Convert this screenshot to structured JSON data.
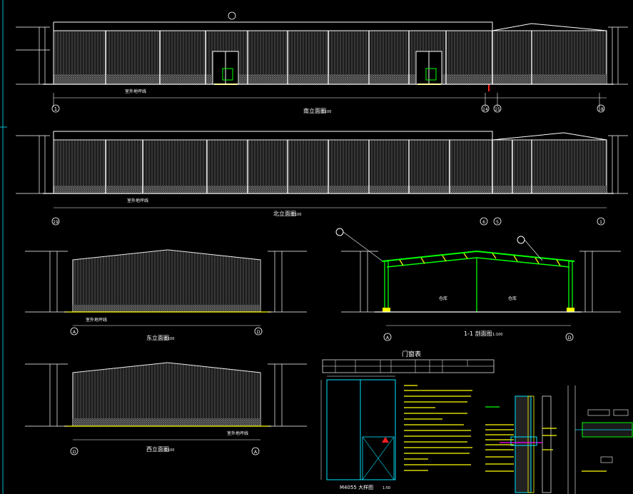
{
  "drawing": {
    "south_title": "南立面图",
    "north_title": "北立面图",
    "east_title": "东立面图",
    "west_title": "西立面图",
    "section_title": "1-1 剖面图",
    "door_title": "门窗表",
    "door_detail_title": "M4055 大样图",
    "scale_100": "1:100",
    "scale_50": "1:50",
    "ground_note": "室外地坪线",
    "axis_labels": {
      "a1": "1",
      "a14": "14",
      "a15": "15",
      "a18": "18",
      "b1": "1",
      "b5": "5",
      "b6": "6",
      "b19": "19",
      "A": "A",
      "D": "D"
    },
    "section_rooms": [
      "仓库",
      "仓库"
    ],
    "colors": {
      "background": "#000000",
      "line_white": "#ffffff",
      "line_yellow": "#ffff00",
      "line_green": "#00ff00",
      "line_cyan": "#00e5ff",
      "line_magenta": "#ff00ff",
      "line_red": "#ff2020"
    }
  }
}
